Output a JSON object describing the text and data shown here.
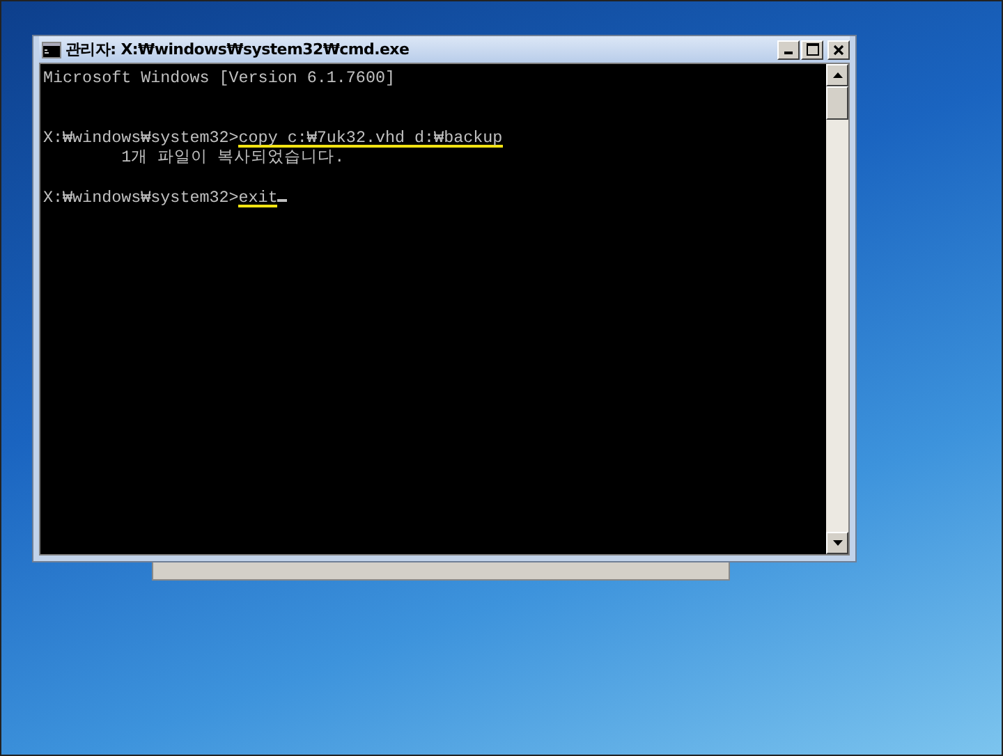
{
  "window": {
    "title": "관리자: X:₩windows₩system32₩cmd.exe"
  },
  "console": {
    "lines": [
      {
        "kind": "text",
        "text": "Microsoft Windows [Version 6.1.7600]"
      },
      {
        "kind": "blank"
      },
      {
        "kind": "blank"
      },
      {
        "kind": "prompt",
        "prompt": "X:₩windows₩system32>",
        "command": "copy c:₩7uk32.vhd d:₩backup",
        "highlighted": true
      },
      {
        "kind": "text",
        "text": "        1개 파일이 복사되었습니다."
      },
      {
        "kind": "blank"
      },
      {
        "kind": "prompt",
        "prompt": "X:₩windows₩system32>",
        "command": "exit",
        "highlighted": true,
        "cursor": true
      }
    ]
  }
}
